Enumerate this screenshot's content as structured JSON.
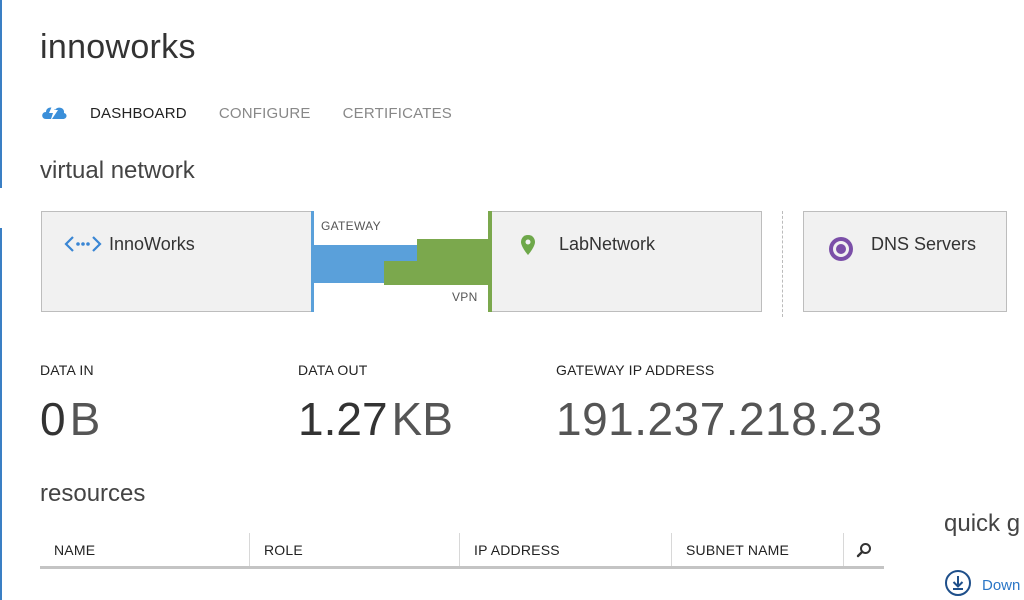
{
  "page": {
    "title": "innoworks"
  },
  "tabs": {
    "cloud_icon": "cloud-services-icon",
    "items": [
      {
        "label": "DASHBOARD",
        "active": true
      },
      {
        "label": "CONFIGURE",
        "active": false
      },
      {
        "label": "CERTIFICATES",
        "active": false
      }
    ]
  },
  "virtual_network": {
    "title": "virtual network",
    "local": {
      "label": "InnoWorks",
      "icon": "virtual-network-icon"
    },
    "gateway": {
      "top_label": "GATEWAY",
      "bottom_label": "VPN",
      "in_color": "#5aa0da",
      "out_color": "#7ba84d"
    },
    "remote": {
      "label": "LabNetwork",
      "icon": "map-pin-icon"
    },
    "dns": {
      "label": "DNS Servers",
      "icon": "dns-target-icon"
    }
  },
  "stats": {
    "data_in": {
      "label": "DATA IN",
      "value": "0",
      "unit": "B"
    },
    "data_out": {
      "label": "DATA OUT",
      "value": "1.27",
      "unit": "KB"
    },
    "gateway_ip": {
      "label": "GATEWAY IP ADDRESS",
      "value": "191.237.218.23"
    }
  },
  "resources": {
    "title": "resources",
    "columns": [
      "NAME",
      "ROLE",
      "IP ADDRESS",
      "SUBNET NAME"
    ],
    "search_icon": "search-icon"
  },
  "quick_glance": {
    "title": "quick g",
    "download_label": "Down",
    "download_icon": "download-icon"
  },
  "colors": {
    "accent": "#3a7fc4",
    "gateway_blue": "#5aa0da",
    "vpn_green": "#7ba84d",
    "dns_purple": "#7b4fa8"
  }
}
